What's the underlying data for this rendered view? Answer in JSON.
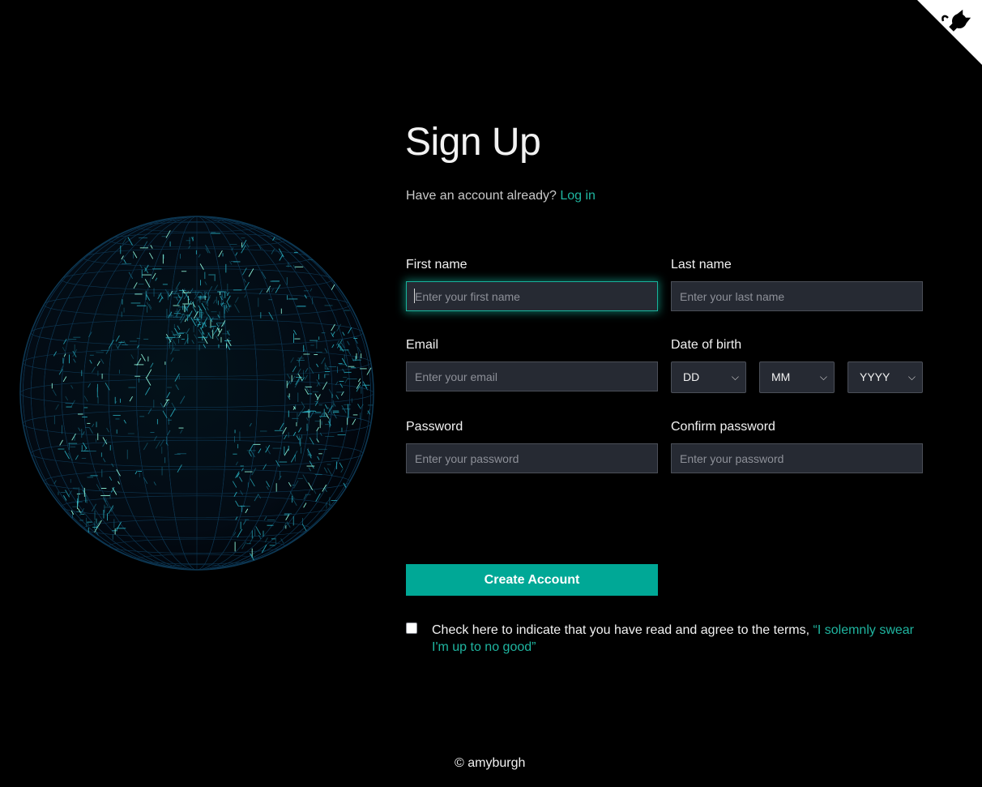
{
  "header": {
    "title": "Sign Up",
    "have_account_text": "Have an account already?",
    "login_link": "Log in"
  },
  "form": {
    "first_name": {
      "label": "First name",
      "placeholder": "Enter your first name",
      "value": ""
    },
    "last_name": {
      "label": "Last name",
      "placeholder": "Enter your last name",
      "value": ""
    },
    "email": {
      "label": "Email",
      "placeholder": "Enter your email",
      "value": ""
    },
    "dob": {
      "label": "Date of birth",
      "day": "DD",
      "month": "MM",
      "year": "YYYY"
    },
    "password": {
      "label": "Password",
      "placeholder": "Enter your password",
      "value": ""
    },
    "confirm_password": {
      "label": "Confirm password",
      "placeholder": "Enter your password",
      "value": ""
    },
    "submit_label": "Create Account",
    "terms_text": "Check here to indicate that you have read and agree to the terms,",
    "terms_link": "“I solemnly swear I'm up to no good”",
    "terms_checked": false
  },
  "footer": {
    "copyright": "© amyburgh"
  },
  "icons": {
    "github_corner": "github-octocat-icon",
    "dropdown": "chevron-down-icon",
    "globe": "wireframe-globe"
  },
  "colors": {
    "background": "#000000",
    "accent": "#00a896",
    "link": "#1fb5a0",
    "input_bg": "#262a33",
    "globe_line": "#1e9fb0"
  }
}
